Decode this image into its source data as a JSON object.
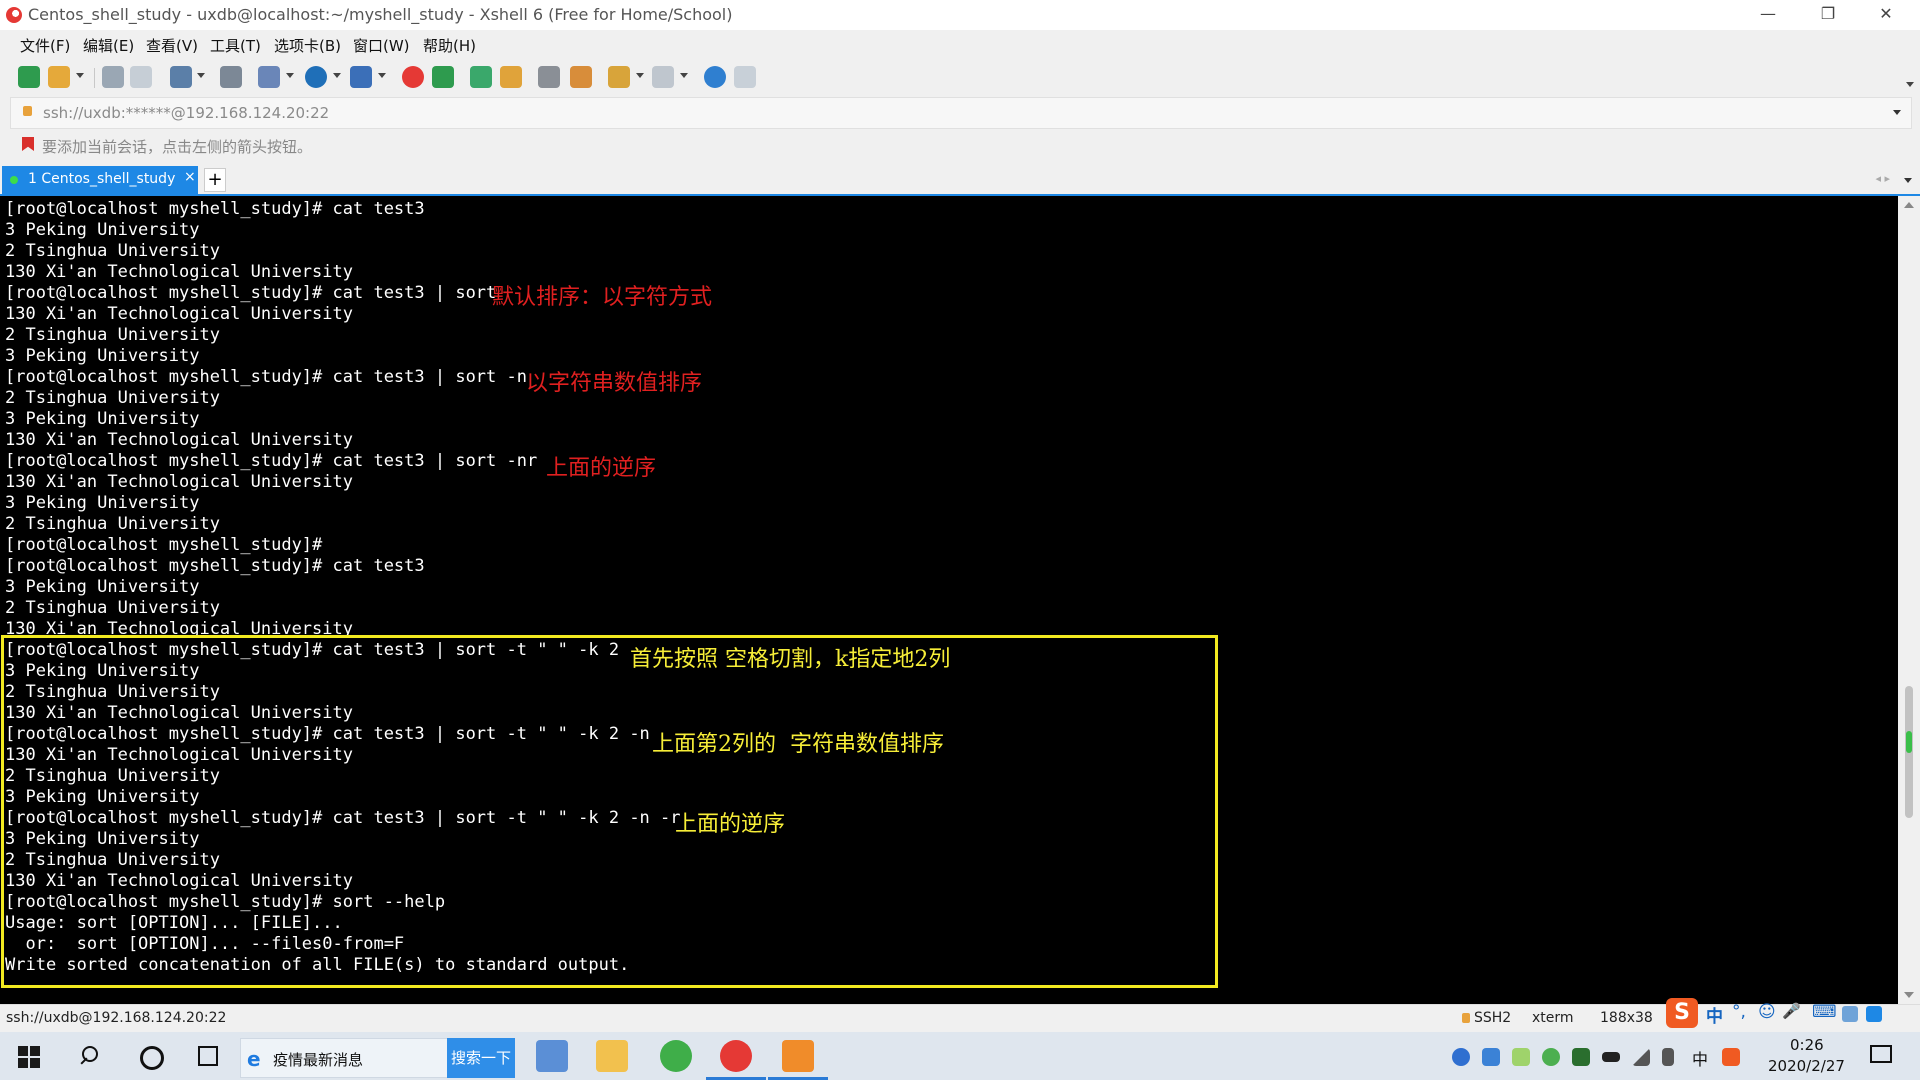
{
  "window": {
    "title": "Centos_shell_study - uxdb@localhost:~/myshell_study - Xshell 6 (Free for Home/School)",
    "minimize": "—",
    "restore": "❐",
    "close": "✕"
  },
  "menu": [
    "文件(F)",
    "编辑(E)",
    "查看(V)",
    "工具(T)",
    "选项卡(B)",
    "窗口(W)",
    "帮助(H)"
  ],
  "address": {
    "value": "ssh://uxdb:******@192.168.124.20:22"
  },
  "hint": {
    "text": "要添加当前会话，点击左侧的箭头按钮。"
  },
  "tabs": [
    {
      "label": "1 Centos_shell_study",
      "close": "×"
    }
  ],
  "tab_add": "+",
  "tab_nav": "◂ ▸",
  "terminal": {
    "lines": [
      "[root@localhost myshell_study]# cat test3",
      "3 Peking University",
      "2 Tsinghua University",
      "130 Xi'an Technological University",
      "[root@localhost myshell_study]# cat test3 | sort",
      "130 Xi'an Technological University",
      "2 Tsinghua University",
      "3 Peking University",
      "[root@localhost myshell_study]# cat test3 | sort -n",
      "2 Tsinghua University",
      "3 Peking University",
      "130 Xi'an Technological University",
      "[root@localhost myshell_study]# cat test3 | sort -nr",
      "130 Xi'an Technological University",
      "3 Peking University",
      "2 Tsinghua University",
      "[root@localhost myshell_study]#",
      "[root@localhost myshell_study]# cat test3",
      "3 Peking University",
      "2 Tsinghua University",
      "130 Xi'an Technological University",
      "[root@localhost myshell_study]# cat test3 | sort -t \" \" -k 2",
      "3 Peking University",
      "2 Tsinghua University",
      "130 Xi'an Technological University",
      "[root@localhost myshell_study]# cat test3 | sort -t \" \" -k 2 -n",
      "130 Xi'an Technological University",
      "2 Tsinghua University",
      "3 Peking University",
      "[root@localhost myshell_study]# cat test3 | sort -t \" \" -k 2 -n -r",
      "3 Peking University",
      "2 Tsinghua University",
      "130 Xi'an Technological University",
      "[root@localhost myshell_study]# sort --help",
      "Usage: sort [OPTION]... [FILE]...",
      "  or:  sort [OPTION]... --files0-from=F",
      "Write sorted concatenation of all FILE(s) to standard output."
    ],
    "annotations": [
      {
        "text": "默认排序：以字符方式",
        "color": "red"
      },
      {
        "text": "以字符串数值排序",
        "color": "red"
      },
      {
        "text": "上面的逆序",
        "color": "red"
      },
      {
        "text": "首先按照 空格切割，k指定地2列",
        "color": "yellow"
      },
      {
        "text": "上面第2列的  字符串数值排序",
        "color": "yellow"
      },
      {
        "text": "上面的逆序",
        "color": "yellow"
      }
    ]
  },
  "status": {
    "connection": "ssh://uxdb@192.168.124.20:22",
    "protocol": "SSH2",
    "terminal_type": "xterm",
    "size": "188x38"
  },
  "ime": {
    "logo": "S",
    "mode": "中",
    "punct": "°,",
    "emoji": "☺",
    "mic": "🎤",
    "keyboard": "⌨"
  },
  "taskbar": {
    "news_text": "疫情最新消息",
    "news_button": "搜索一下",
    "clock_time": "0:26",
    "clock_date": "2020/2/27",
    "lang": "中"
  },
  "colors": {
    "accent": "#1e88e5",
    "annotation_red": "#e02020",
    "annotation_yellow": "#f7ee38",
    "box": "#f2ea20"
  }
}
